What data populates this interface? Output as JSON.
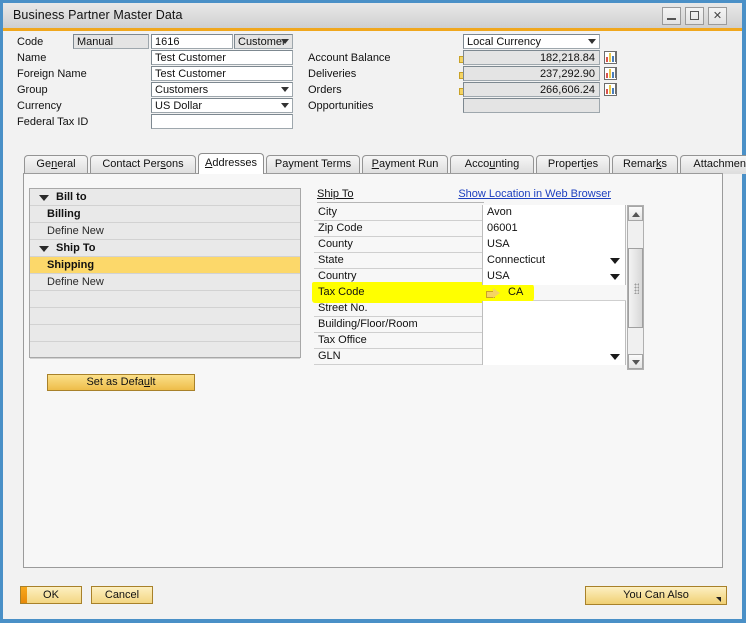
{
  "window": {
    "title": "Business Partner Master Data",
    "controls": {
      "minimize": "_",
      "maximize": "□",
      "close": "✕"
    },
    "accent_color": "#f0a71e",
    "border_color": "#4a90c7"
  },
  "header": {
    "left_fields": [
      {
        "label": "Code",
        "value": "Manual",
        "value2": "1616",
        "type_value": "Customer"
      },
      {
        "label": "Name",
        "value": "Test Customer"
      },
      {
        "label": "Foreign Name",
        "value": "Test Customer"
      },
      {
        "label": "Group",
        "value": "Customers"
      },
      {
        "label": "Currency",
        "value": "US Dollar"
      },
      {
        "label": "Federal Tax ID",
        "value": ""
      }
    ],
    "currency_selector": "Local Currency",
    "right_fields": [
      {
        "label": "Account Balance",
        "value": "182,218.84",
        "has_arrow": true,
        "has_chart": true
      },
      {
        "label": "Deliveries",
        "value": "237,292.90",
        "has_arrow": true,
        "has_chart": true
      },
      {
        "label": "Orders",
        "value": "266,606.24",
        "has_arrow": true,
        "has_chart": true
      },
      {
        "label": "Opportunities",
        "value": "",
        "has_arrow": false,
        "has_chart": false
      }
    ]
  },
  "tabs": [
    {
      "label": "General",
      "accel": "n",
      "active": false
    },
    {
      "label": "Contact Persons",
      "accel": "s",
      "active": false
    },
    {
      "label": "Addresses",
      "accel": "A",
      "active": true
    },
    {
      "label": "Payment Terms",
      "accel": "",
      "active": false
    },
    {
      "label": "Payment Run",
      "accel": "P",
      "active": false
    },
    {
      "label": "Accounting",
      "accel": "u",
      "active": false
    },
    {
      "label": "Properties",
      "accel": "i",
      "active": false
    },
    {
      "label": "Remarks",
      "accel": "k",
      "active": false
    },
    {
      "label": "Attachments",
      "accel": "",
      "active": false
    }
  ],
  "address_tree": {
    "rows": [
      {
        "label": "Bill to",
        "kind": "group",
        "expanded": true,
        "selected": false
      },
      {
        "label": "Billing",
        "kind": "child",
        "selected": false
      },
      {
        "label": "Define New",
        "kind": "define",
        "selected": false
      },
      {
        "label": "Ship To",
        "kind": "group",
        "expanded": true,
        "selected": false
      },
      {
        "label": "Shipping",
        "kind": "child",
        "selected": true
      },
      {
        "label": "Define New",
        "kind": "define",
        "selected": false
      },
      {
        "label": "",
        "kind": "blank"
      },
      {
        "label": "",
        "kind": "blank"
      },
      {
        "label": "",
        "kind": "blank"
      },
      {
        "label": "",
        "kind": "blank"
      }
    ],
    "selected_row_color": "#fcd86a"
  },
  "set_as_default": {
    "label_before": "Set as Defa",
    "accel": "u",
    "label_after": "lt"
  },
  "ship_to": {
    "title": "Ship To",
    "web_link": "Show Location in Web Browser",
    "rows": [
      {
        "label": "City",
        "value": "Avon",
        "dropdown": false,
        "highlight": false
      },
      {
        "label": "Zip Code",
        "value": "06001",
        "dropdown": false,
        "highlight": false
      },
      {
        "label": "County",
        "value": "USA",
        "dropdown": false,
        "highlight": false
      },
      {
        "label": "State",
        "value": "Connecticut",
        "dropdown": true,
        "highlight": false
      },
      {
        "label": "Country",
        "value": "USA",
        "dropdown": true,
        "highlight": false
      },
      {
        "label": "Tax Code",
        "value": "CA",
        "dropdown": false,
        "highlight": true,
        "has_arrow": true
      },
      {
        "label": "Street No.",
        "value": "",
        "dropdown": false,
        "highlight": false
      },
      {
        "label": "Building/Floor/Room",
        "value": "",
        "dropdown": false,
        "highlight": false
      },
      {
        "label": "Tax Office",
        "value": "",
        "dropdown": false,
        "highlight": false
      },
      {
        "label": "GLN",
        "value": "",
        "dropdown": true,
        "highlight": false
      }
    ],
    "highlight_color": "#ffff00"
  },
  "footer": {
    "ok": "OK",
    "cancel": "Cancel",
    "you_can_also": "You Can Also"
  }
}
